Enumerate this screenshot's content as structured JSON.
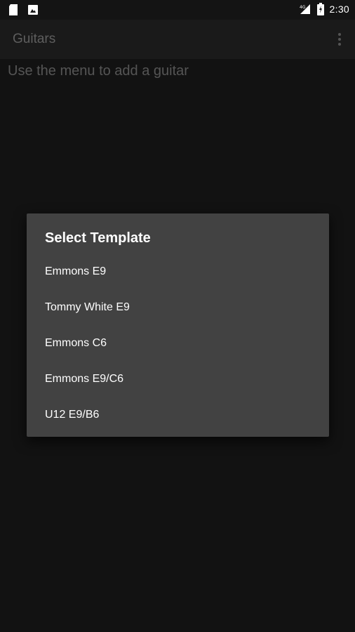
{
  "status_bar": {
    "left_icons": [
      "sd-card-icon",
      "photo-notification-icon"
    ],
    "right_icons": [
      "signal-icon",
      "battery-icon"
    ],
    "time": "2:30"
  },
  "app_bar": {
    "title": "Guitars",
    "menu_icon": "overflow-menu-icon"
  },
  "main": {
    "empty_message": "Use the menu to add a guitar"
  },
  "dialog": {
    "title": "Select Template",
    "items": [
      {
        "label": "Emmons E9"
      },
      {
        "label": "Tommy White E9"
      },
      {
        "label": "Emmons C6"
      },
      {
        "label": "Emmons E9/C6"
      },
      {
        "label": "U12 E9/B6"
      }
    ]
  },
  "colors": {
    "background": "#121212",
    "app_bar": "#1a1a1a",
    "dialog": "#424242",
    "dialog_text": "#ffffff",
    "muted_text": "#5e5e5e"
  }
}
